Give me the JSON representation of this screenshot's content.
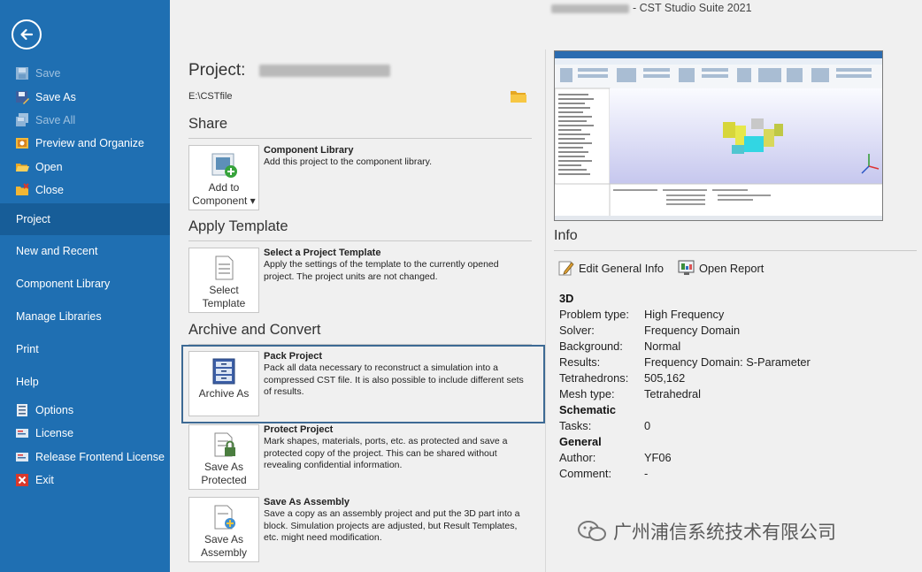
{
  "window_title": "- CST Studio Suite 2021",
  "sidebar": {
    "commands": [
      {
        "label": "Save",
        "icon": "save-icon",
        "enabled": false
      },
      {
        "label": "Save As",
        "icon": "save-as-icon",
        "enabled": true
      },
      {
        "label": "Save All",
        "icon": "save-all-icon",
        "enabled": false
      },
      {
        "label": "Preview and Organize",
        "icon": "preview-icon",
        "enabled": true
      },
      {
        "label": "Open",
        "icon": "open-folder-icon",
        "enabled": true
      },
      {
        "label": "Close",
        "icon": "close-folder-icon",
        "enabled": true
      }
    ],
    "nav": [
      {
        "label": "Project",
        "selected": true
      },
      {
        "label": "New and Recent",
        "selected": false
      },
      {
        "label": "Component Library",
        "selected": false
      },
      {
        "label": "Manage Libraries",
        "selected": false
      },
      {
        "label": "Print",
        "selected": false
      },
      {
        "label": "Help",
        "selected": false
      }
    ],
    "bottom": [
      {
        "label": "Options",
        "icon": "options-icon"
      },
      {
        "label": "License",
        "icon": "license-icon"
      },
      {
        "label": "Release Frontend License",
        "icon": "release-license-icon"
      },
      {
        "label": "Exit",
        "icon": "exit-icon"
      }
    ]
  },
  "project": {
    "label": "Project:",
    "path": "E:\\CSTfile"
  },
  "sections": {
    "share": "Share",
    "apply_template": "Apply Template",
    "archive": "Archive and Convert"
  },
  "items": {
    "component_library": {
      "tile": "Add to\nComponent ▾",
      "title": "Component Library",
      "desc": "Add this project to the component library."
    },
    "select_template": {
      "tile": "Select\nTemplate",
      "title": "Select a Project Template",
      "desc": "Apply the settings of the template to the currently opened project. The project units are not changed."
    },
    "pack_project": {
      "tile": "Archive As",
      "title": "Pack Project",
      "desc": "Pack all data necessary to reconstruct a simulation into a compressed CST file. It is also possible to include different sets of results."
    },
    "protect_project": {
      "tile": "Save As\nProtected",
      "title": "Protect Project",
      "desc": "Mark shapes, materials, ports, etc. as protected and save a protected copy of the project. This can be shared without revealing confidential information."
    },
    "save_assembly": {
      "tile": "Save As\nAssembly",
      "title": "Save As Assembly",
      "desc": "Save a copy as an assembly project and put the 3D part into a block. Simulation projects are adjusted, but Result Templates, etc. might need modification."
    }
  },
  "info": {
    "heading": "Info",
    "edit_general_info": "Edit General Info",
    "open_report": "Open Report",
    "groups": [
      {
        "name": "3D",
        "rows": [
          {
            "key": "Problem type:",
            "value": "High Frequency"
          },
          {
            "key": "Solver:",
            "value": "Frequency Domain"
          },
          {
            "key": "Background:",
            "value": "Normal"
          },
          {
            "key": "Results:",
            "value": "Frequency Domain: S-Parameter"
          },
          {
            "key": "Tetrahedrons:",
            "value": "505,162"
          },
          {
            "key": "Mesh type:",
            "value": "Tetrahedral"
          }
        ]
      },
      {
        "name": "Schematic",
        "rows": [
          {
            "key": "Tasks:",
            "value": "0"
          }
        ]
      },
      {
        "name": "General",
        "rows": [
          {
            "key": "Author:",
            "value": "YF06"
          },
          {
            "key": "Comment:",
            "value": "-"
          }
        ]
      }
    ]
  },
  "watermark": "广州浦信系统技术有限公司",
  "colors": {
    "sidebar": "#1f6fb2",
    "sidebar_selected": "#175d98",
    "highlight_border": "#3d6a94"
  }
}
